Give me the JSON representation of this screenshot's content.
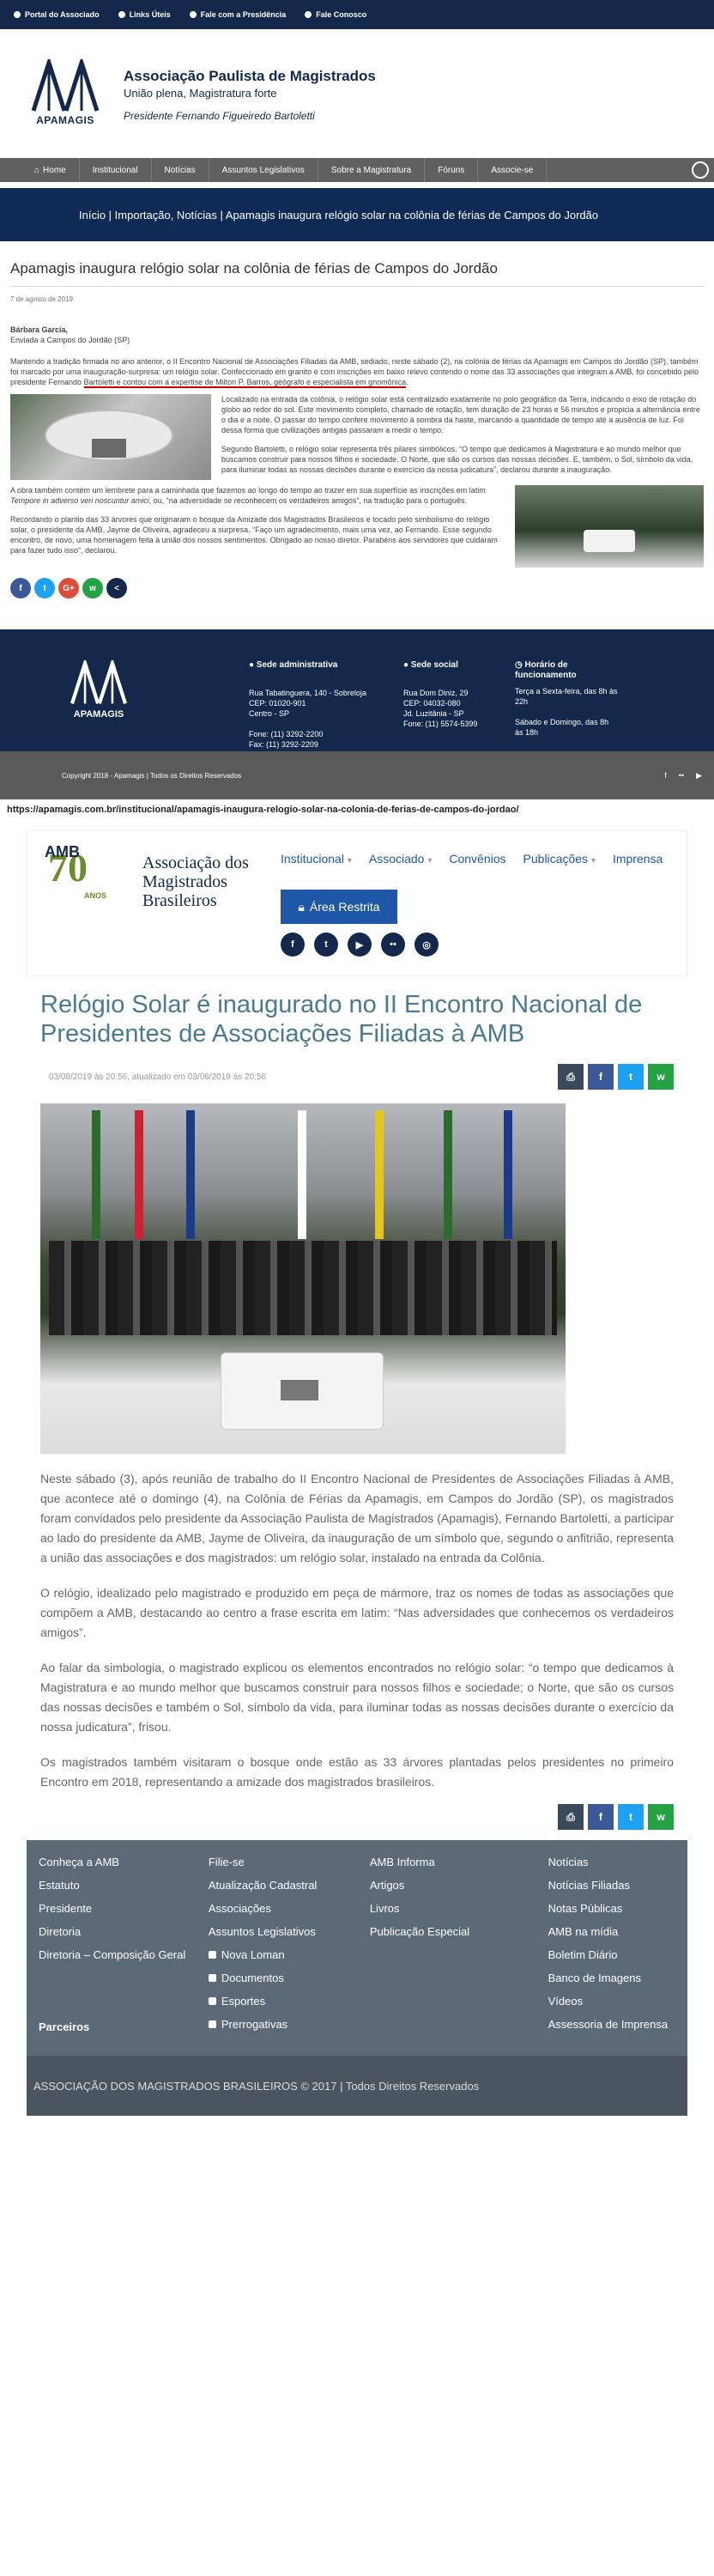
{
  "topbar": {
    "items": [
      "Portal do Associado",
      "Links Úteis",
      "Fale com a Presidência",
      "Fale Conosco"
    ]
  },
  "brand": {
    "logo_text": "APAMAGIS",
    "name": "Associação Paulista de Magistrados",
    "motto": "União plena, Magistratura forte",
    "president": "Presidente Fernando Figueiredo Bartoletti"
  },
  "nav": {
    "items": [
      "Home",
      "Institucional",
      "Notícias",
      "Assuntos Legislativos",
      "Sobre a Magistratura",
      "Fóruns",
      "Associe-se"
    ]
  },
  "breadcrumb": "Início | Importação, Notícias | Apamagis inaugura relógio solar na colônia de férias de Campos do Jordão",
  "article": {
    "title": "Apamagis inaugura relógio solar na colônia de férias de Campos do Jordão",
    "date": "7 de agosto de 2019",
    "author": "Bárbara Garcia,",
    "source": "Enviada a Campos do Jordão (SP)",
    "p1a": "Mantendo a tradição firmada no ano anterior, o II Encontro Nacional de Associações Filiadas da AMB, sediado, neste sábado (2), na colônia de férias da Apamagis em Campos do Jordão (SP), também foi marcado por uma inauguração-surpresa: um relógio solar. Confeccionado em granito e com inscrições em baixo relevo contendo o nome das 33 associações que integram a AMB, foi concebido pelo presidente Fernando ",
    "p1b": "Bartoletti e contou com a expertise de Milton P. Barros, geógrafo e especialista em gnomônica",
    "p1c": ".",
    "p2": "Localizado na entrada da colônia, o relógio solar está centralizado exatamente no polo geográfico da Terra, indicando o eixo de rotação do globo ao redor do sol. Este movimento completo, chamado de rotação, tem duração de 23 horas e 56 minutos e propicia a alternância entre o dia e a noite. O passar do tempo confere movimento à sombra da haste, marcando a quantidade de tempo até a ausência de luz. Foi dessa forma que civilizações antigas passaram a medir o tempo.",
    "p3": "Segundo Bartoletti, o relógio solar representa três pilares simbólicos. “O tempo que dedicamos à Magistratura e ao mundo melhor que buscamos construir para nossos filhos e sociedade. O Norte, que são os cursos das nossas decisões. E, também, o Sol, símbolo da vida, para iluminar todas as nossas decisões durante o exercício da nossa judicatura”, declarou durante a inauguração.",
    "p4a": "A obra também contém um lembrete para a caminhada que fazemos ao longo do tempo ao trazer em sua superfície as inscrições em latim ",
    "p4b": "Tempore in adverso veri noscuntur amici",
    "p4c": ", ou, “na adversidade se reconhecem os verdadeiros amigos”, na tradução para o português.",
    "p5": "Recordando o plantio das 33 árvores que originaram o bosque da Amizade dos Magistrados Brasileiros e tocado pelo simbolismo do relógio solar, o presidente da AMB, Jayme de Oliveira, agradeceu a surpresa. “Faço um agradecimento, mais uma vez, ao Fernando. Esse segundo encontro, de novo, uma homenagem feita à união dos nossos sentimentos. Obrigado ao nosso diretor. Parabéns aos servidores que cuidaram para fazer tudo isso”, declarou."
  },
  "share": [
    "f",
    "t",
    "G+",
    "w",
    "<"
  ],
  "footer": {
    "logo_text": "APAMAGIS",
    "sede_adm_title": "Sede administrativa",
    "sede_adm_lines": [
      "Rua Tabatinguera, 140 - Sobreloja",
      "CEP: 01020-901",
      "Centro - SP",
      "",
      "Fone: (11) 3292-2200",
      "Fax: (11) 3292-2209"
    ],
    "sede_social_title": "Sede social",
    "sede_social_lines": [
      "Rua Dom Diniz, 29",
      "CEP: 04032-080",
      "Jd. Luzitânia - SP",
      "Fone: (11) 5574-5399"
    ],
    "horario_title": "Horário de funcionamento",
    "horario_lines": [
      "Terça a Sexta-feira, das 8h às 22h",
      "",
      "Sábado e Domingo, das 8h às 18h"
    ],
    "copyright": "Copyright 2018 - Apamagis | Todos os Direitos Reservados"
  },
  "url": "https://apamagis.com.br/institucional/apamagis-inaugura-relogio-solar-na-colonia-de-ferias-de-campos-do-jordao/",
  "amb": {
    "logo_amb": "AMB",
    "logo_70": "70",
    "logo_anos": "ANOS",
    "logo_name": "Associação dos Magistrados Brasileiros",
    "nav": [
      "Institucional",
      "Associado",
      "Convênios",
      "Publicações",
      "Imprensa"
    ],
    "restricted": "Área Restrita",
    "social": [
      "f",
      "t",
      "▶",
      "••",
      "◎"
    ],
    "title": "Relógio Solar é inaugurado no II Encontro Nacional de Presidentes de Associações Filiadas à AMB",
    "meta": "03/08/2019 às 20:56, atualizado em 03/08/2019 às 20:56",
    "body": [
      "Neste sábado (3), após reunião de trabalho do II Encontro Nacional de Presidentes de Associações Filiadas à AMB, que acontece até o domingo (4), na Colônia de Férias da Apamagis, em Campos do Jordão (SP), os magistrados foram convidados pelo presidente da Associação Paulista de Magistrados (Apamagis), Fernando Bartoletti, a participar ao lado do presidente da AMB, Jayme de Oliveira, da inauguração de um símbolo que, segundo o anfitrião, representa a união das associações e dos magistrados: um relógio solar, instalado na entrada da Colônia.",
      "O relógio, idealizado pelo magistrado e produzido em peça de mármore, traz os nomes de todas as associações que compõem a AMB, destacando ao centro a frase escrita em latim: “Nas adversidades que conhecemos os verdadeiros amigos”.",
      "Ao falar da simbologia, o magistrado explicou os elementos encontrados no relógio solar: “o tempo que dedicamos à Magistratura e ao mundo melhor que buscamos construir para nossos filhos e sociedade; o Norte, que são os cursos das nossas decisões e também o Sol, símbolo da vida, para iluminar todas as nossas decisões durante o exercício da nossa judicatura”, frisou.",
      "Os magistrados também visitaram o bosque onde estão as 33 árvores plantadas pelos presidentes no primeiro Encontro em 2018, representando a amizade dos magistrados brasileiros."
    ],
    "footer_cols": [
      [
        "Conheça a AMB",
        "Estatuto",
        "Presidente",
        "Diretoria",
        "Diretoria – Composição Geral"
      ],
      [
        "Filie-se",
        "Atualização Cadastral",
        "Associações",
        "Assuntos Legislativos",
        "Nova Loman",
        "Documentos",
        "Esportes",
        "Prerrogativas"
      ],
      [
        "AMB Informa",
        "Artigos",
        "Livros",
        "Publicação Especial"
      ],
      [
        "Notícias",
        "Notícias Filiadas",
        "Notas Públicas",
        "AMB na mídia",
        "Boletim Diário",
        "Banco de Imagens",
        "Vídeos",
        "Assessoria de Imprensa"
      ]
    ],
    "partners": "Parceiros",
    "copyright": "ASSOCIAÇÃO DOS MAGISTRADOS BRASILEIROS © 2017 | Todos Direitos Reservados"
  },
  "colors": {
    "navy": "#13284b",
    "amb_blue": "#1f57a8",
    "amb_title": "#4a7a92",
    "facebook": "#3b5998",
    "twitter": "#1da1f2",
    "google": "#dd4b39",
    "whatsapp": "#25a244",
    "red_underline": "#cc0000"
  }
}
